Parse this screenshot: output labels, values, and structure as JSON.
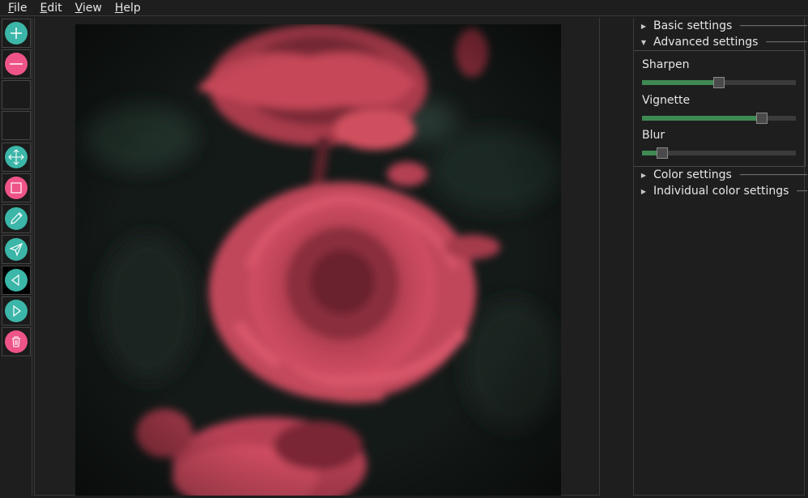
{
  "menu": [
    {
      "label": "File",
      "first": "F",
      "rest": "ile"
    },
    {
      "label": "Edit",
      "first": "E",
      "rest": "dit"
    },
    {
      "label": "View",
      "first": "V",
      "rest": "iew"
    },
    {
      "label": "Help",
      "first": "H",
      "rest": "elp"
    }
  ],
  "tools": [
    {
      "name": "add",
      "icon": "plus-icon",
      "color": "teal"
    },
    {
      "name": "remove",
      "icon": "minus-icon",
      "color": "pink"
    },
    {
      "name": "empty-1",
      "icon": "",
      "color": ""
    },
    {
      "name": "empty-2",
      "icon": "",
      "color": ""
    },
    {
      "name": "move",
      "icon": "move-arrows-icon",
      "color": "teal"
    },
    {
      "name": "rectangle",
      "icon": "square-icon",
      "color": "pink"
    },
    {
      "name": "draw",
      "icon": "pencil-icon",
      "color": "teal"
    },
    {
      "name": "send",
      "icon": "send-icon",
      "color": "teal"
    },
    {
      "name": "previous",
      "icon": "triangle-left-icon",
      "color": "teal"
    },
    {
      "name": "next",
      "icon": "triangle-right-icon",
      "color": "teal"
    },
    {
      "name": "delete",
      "icon": "trash-icon",
      "color": "pink"
    }
  ],
  "panel": {
    "basic": "Basic settings",
    "advanced": "Advanced settings",
    "color": "Color settings",
    "individual": "Individual color settings",
    "sliders": [
      {
        "label": "Sharpen",
        "value": 0.5
      },
      {
        "label": "Vignette",
        "value": 0.78
      },
      {
        "label": "Blur",
        "value": 0.13
      }
    ]
  },
  "colors": {
    "teal": "#3bb6a8",
    "pink": "#ee5487",
    "slider_fill": "#3f8a52",
    "rose": "#c8475a"
  }
}
